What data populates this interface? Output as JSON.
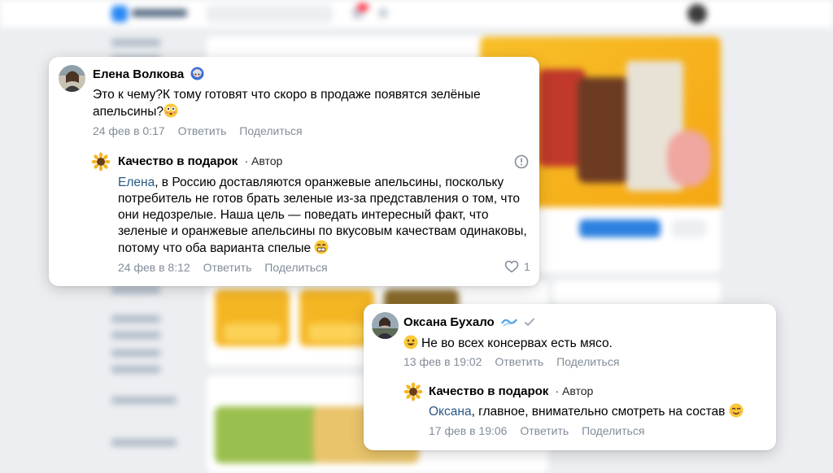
{
  "comments": [
    {
      "author": "Елена Волкова",
      "text": "Это к чему?К тому готовят что скоро в продаже появятся зелёные апельсины?",
      "date": "24 фев в 0:17",
      "reply_label": "Ответить",
      "share_label": "Поделиться",
      "reply": {
        "author": "Качество в подарок",
        "author_tag": "· Автор",
        "mention": "Елена",
        "text": ", в Россию доставляются оранжевые апельсины, поскольку потребитель не готов брать зеленые из-за представления о том, что они недозрелые. Наша цель — поведать интересный факт, что зеленые и оранжевые апельсины по вкусовым качествам одинаковы, потому что оба варианта спелые",
        "date": "24 фев в 8:12",
        "reply_label": "Ответить",
        "share_label": "Поделиться",
        "likes": "1"
      }
    },
    {
      "author": "Оксана Бухало",
      "text": "Не во всех консервах есть мясо.",
      "date": "13 фев в 19:02",
      "reply_label": "Ответить",
      "share_label": "Поделиться",
      "reply": {
        "author": "Качество в подарок",
        "author_tag": "· Автор",
        "mention": "Оксана",
        "text": ", главное, внимательно смотреть на состав",
        "date": "17 фев в 19:06",
        "reply_label": "Ответить",
        "share_label": "Поделиться"
      }
    }
  ],
  "colors": {
    "link": "#2a5885",
    "meta": "#818c99",
    "background": "#eceef1",
    "brand_yellow": "#f5b624"
  },
  "icons": [
    "astronaut-emoji-icon",
    "sunflower-avatar-icon",
    "info-icon",
    "heart-icon",
    "verified-check-icon",
    "wave-emoji-icon",
    "smile-emoji-icon",
    "flushed-emoji-icon",
    "grin-emoji-icon"
  ]
}
